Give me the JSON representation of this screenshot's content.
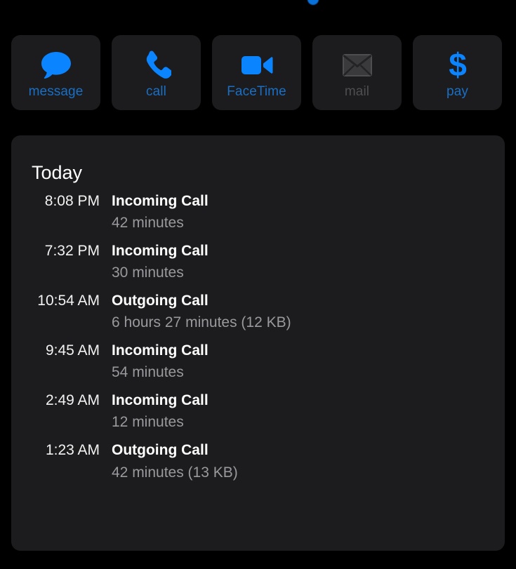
{
  "accent_colors": {
    "blue_icon": "#0a84ff",
    "blue_label": "#1a6fc4",
    "disabled_grey": "#4e4e51",
    "card_bg": "#1c1c1e",
    "page_bg": "#000000",
    "primary_text": "#ffffff",
    "secondary_text": "#9a9a9e"
  },
  "actions": [
    {
      "id": "message",
      "label": "message",
      "icon": "message-bubble-icon",
      "enabled": true
    },
    {
      "id": "call",
      "label": "call",
      "icon": "phone-handset-icon",
      "enabled": true
    },
    {
      "id": "facetime",
      "label": "FaceTime",
      "icon": "video-camera-icon",
      "enabled": true
    },
    {
      "id": "mail",
      "label": "mail",
      "icon": "envelope-icon",
      "enabled": false
    },
    {
      "id": "pay",
      "label": "pay",
      "icon": "dollar-sign-icon",
      "enabled": true
    }
  ],
  "history": {
    "title": "Today",
    "entries": [
      {
        "time": "8:08 PM",
        "type": "Incoming Call",
        "detail": "42 minutes"
      },
      {
        "time": "7:32 PM",
        "type": "Incoming Call",
        "detail": "30 minutes"
      },
      {
        "time": "10:54 AM",
        "type": "Outgoing Call",
        "detail": "6 hours 27 minutes (12 KB)"
      },
      {
        "time": "9:45 AM",
        "type": "Incoming Call",
        "detail": "54 minutes"
      },
      {
        "time": "2:49 AM",
        "type": "Incoming Call",
        "detail": "12 minutes"
      },
      {
        "time": "1:23 AM",
        "type": "Outgoing Call",
        "detail": "42 minutes (13 KB)"
      }
    ]
  }
}
